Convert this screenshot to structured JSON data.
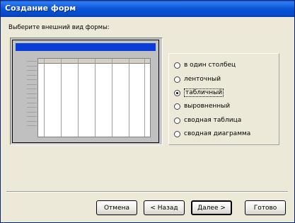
{
  "window": {
    "title": "Создание форм",
    "subtitle": "Выберите внешний вид формы:"
  },
  "options": [
    {
      "label": "в один столбец",
      "checked": false
    },
    {
      "label": "ленточный",
      "checked": false
    },
    {
      "label": "табличный",
      "checked": true
    },
    {
      "label": "выровненный",
      "checked": false
    },
    {
      "label": "сводная таблица",
      "checked": false
    },
    {
      "label": "сводная диаграмма",
      "checked": false
    }
  ],
  "buttons": {
    "cancel": "Отмена",
    "back": "< Назад",
    "next": "Далее >",
    "finish": "Готово"
  },
  "colors": {
    "titlebar": "#0a54d8",
    "preview_bar": "#0a3cd8",
    "dialog_bg": "#ece9d8"
  }
}
